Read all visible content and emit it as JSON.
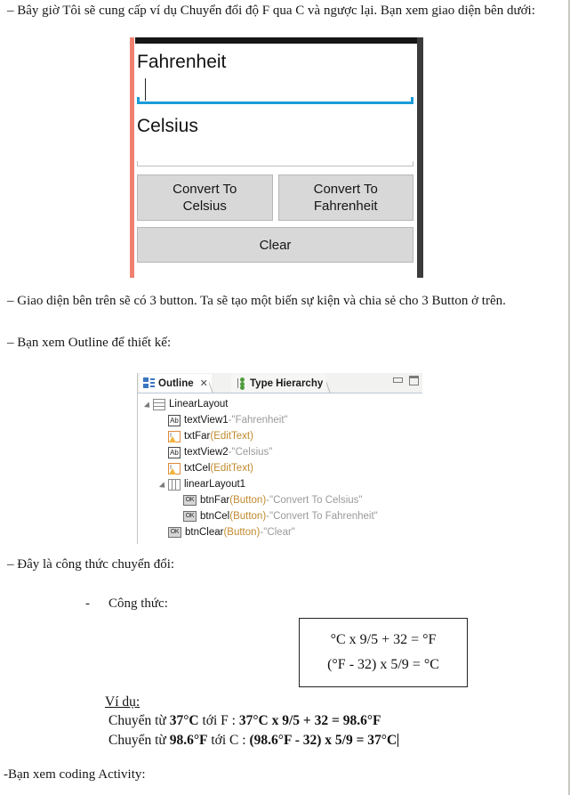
{
  "document": {
    "paragraph_intro": "– Bây giờ Tôi sẽ cung cấp ví dụ Chuyển đổi độ F qua C và ngược lại. Bạn xem giao diện bên dưới:",
    "paragraph_three_buttons": "– Giao diện bên trên sẽ có 3 button. Ta sẽ tạo một biến sự kiện và chia sẻ cho 3 Button ở trên.",
    "paragraph_outline": "– Bạn xem Outline để thiết kế:",
    "paragraph_formula_intro": "– Đây là công thức chuyển đổi:",
    "bullet_dash": "-",
    "bullet_congthuc": "Công thức:",
    "paragraph_coding": "-Bạn xem coding Activity:"
  },
  "android_mockup": {
    "label_fahrenheit": "Fahrenheit",
    "label_celsius": "Celsius",
    "input_fahrenheit_value": "",
    "input_celsius_value": "",
    "button_convert_to_celsius": "Convert To\nCelsius",
    "button_convert_to_celsius_line1": "Convert To",
    "button_convert_to_celsius_line2": "Celsius",
    "button_convert_to_fahrenheit_line1": "Convert To",
    "button_convert_to_fahrenheit_line2": "Fahrenheit",
    "button_clear": "Clear",
    "colors": {
      "focus_underline": "#1a9cd8",
      "left_accent": "#f08070",
      "right_frame": "#3b3b3b",
      "top_frame": "#161616",
      "button_face": "#d8d8d8"
    }
  },
  "outline_view": {
    "tabs": [
      {
        "label": "Outline",
        "icon": "outline-icon",
        "active": true,
        "close_glyph": "✕"
      },
      {
        "label": "Type Hierarchy",
        "icon": "type-hierarchy-icon",
        "active": false
      }
    ],
    "window_buttons": [
      {
        "name": "minimize-button"
      },
      {
        "name": "maximize-button"
      }
    ],
    "tree": [
      {
        "indent": 0,
        "arrow": true,
        "icon": "linear-layout-vertical-icon",
        "name": "LinearLayout",
        "type": "",
        "sep": "",
        "text": ""
      },
      {
        "indent": 1,
        "arrow": false,
        "icon": "textview-icon",
        "name": "textView1",
        "type": "",
        "sep": " - ",
        "text": "\"Fahrenheit\""
      },
      {
        "indent": 1,
        "arrow": false,
        "icon": "edittext-warning-icon",
        "name": "txtFar",
        "type": " (EditText)",
        "sep": "",
        "text": ""
      },
      {
        "indent": 1,
        "arrow": false,
        "icon": "textview-icon",
        "name": "textView2",
        "type": "",
        "sep": " - ",
        "text": "\"Celsius\""
      },
      {
        "indent": 1,
        "arrow": false,
        "icon": "edittext-warning-icon",
        "name": "txtCel",
        "type": " (EditText)",
        "sep": "",
        "text": ""
      },
      {
        "indent": 1,
        "arrow": true,
        "icon": "linear-layout-horizontal-icon",
        "name": "linearLayout1",
        "type": "",
        "sep": "",
        "text": ""
      },
      {
        "indent": 2,
        "arrow": false,
        "icon": "button-icon",
        "name": "btnFar",
        "type": " (Button)",
        "sep": " - ",
        "text": "\"Convert To Celsius\""
      },
      {
        "indent": 2,
        "arrow": false,
        "icon": "button-icon",
        "name": "btnCel",
        "type": " (Button)",
        "sep": " - ",
        "text": "\"Convert To Fahrenheit\""
      },
      {
        "indent": 1,
        "arrow": false,
        "icon": "button-icon",
        "name": "btnClear",
        "type": " (Button)",
        "sep": " - ",
        "text": "\"Clear\""
      }
    ]
  },
  "formula_box": {
    "line1": "°C x 9/5 + 32 = °F",
    "line2": "(°F - 32) x 5/9 = °C"
  },
  "example": {
    "title": "Ví dụ:",
    "line1_prefix": "Chuyển từ ",
    "line1_b1": "37°C",
    "line1_mid": " tới F : ",
    "line1_b2": "37°C x  9/5 + 32 = 98.6°F",
    "line2_prefix": "Chuyển từ ",
    "line2_b1": "98.6°F",
    "line2_mid": " tới C : ",
    "line2_b2": "(98.6°F  -  32)  x  5/9 = 37°C"
  }
}
